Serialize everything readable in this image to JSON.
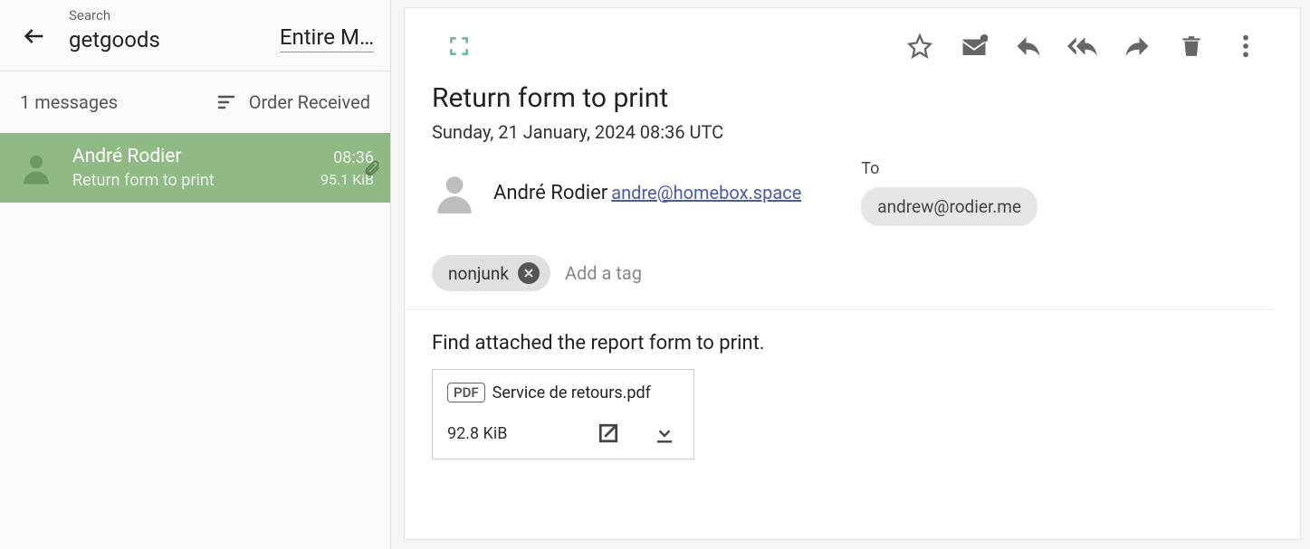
{
  "search": {
    "label": "Search",
    "query": "getgoods",
    "scope": "Entire M…"
  },
  "list": {
    "count_label": "1 messages",
    "sort_label": "Order Received"
  },
  "messages": [
    {
      "sender": "André Rodier",
      "subject": "Return form to print",
      "time": "08:36",
      "size": "95.1 KiB"
    }
  ],
  "email": {
    "subject": "Return form to print",
    "date": "Sunday, 21 January, 2024 08:36 UTC",
    "from_name": "André Rodier",
    "from_email": "andre@homebox.space",
    "to_label": "To",
    "to": "andrew@rodier.me",
    "tags": [
      {
        "name": "nonjunk"
      }
    ],
    "add_tag_placeholder": "Add a tag",
    "body": "Find attached the report form to print.",
    "attachment": {
      "type": "PDF",
      "name": "Service de retours.pdf",
      "size": "92.8 KiB"
    }
  }
}
